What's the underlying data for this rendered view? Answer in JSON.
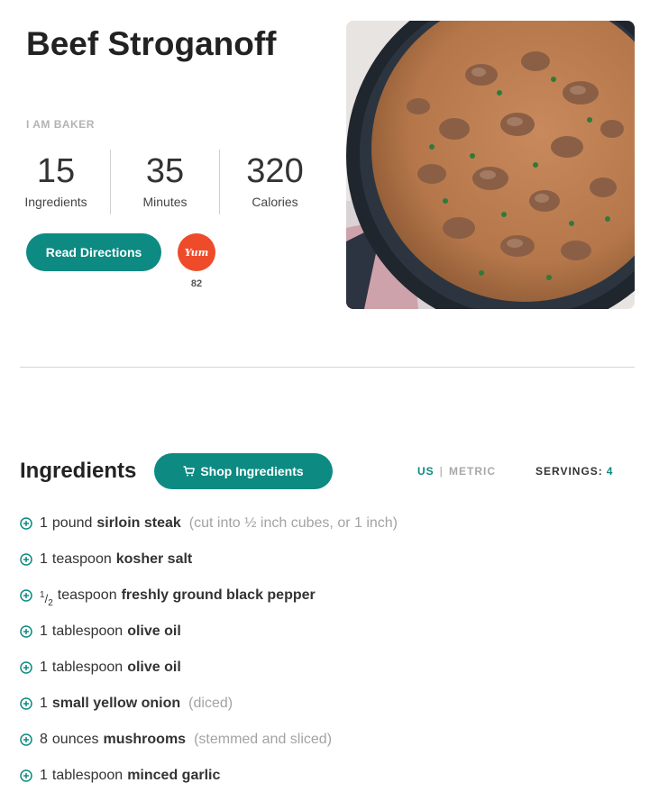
{
  "recipe": {
    "title": "Beef Stroganoff",
    "author": "I AM BAKER",
    "stats": [
      {
        "value": "15",
        "label": "Ingredients"
      },
      {
        "value": "35",
        "label": "Minutes"
      },
      {
        "value": "320",
        "label": "Calories"
      }
    ],
    "read_directions_label": "Read Directions",
    "yum_label": "Yum",
    "yum_count": "82",
    "photo_icon": "beef-stroganoff-skillet-photo"
  },
  "ingredients": {
    "heading": "Ingredients",
    "shop_label": "Shop Ingredients",
    "shop_icon": "cart-icon",
    "unit_us": "US",
    "unit_separator": "|",
    "unit_metric": "METRIC",
    "servings_label": "SERVINGS:",
    "servings_value": "4",
    "items": [
      {
        "qty": "1",
        "unit": "pound",
        "name": "sirloin steak",
        "note": "(cut into ½ inch cubes, or 1 inch)"
      },
      {
        "qty": "1",
        "unit": "teaspoon",
        "name": "kosher salt",
        "note": ""
      },
      {
        "qty_num": "1",
        "qty_slash": "/",
        "qty_den": "2",
        "unit": "teaspoon",
        "name": "freshly ground black pepper",
        "note": ""
      },
      {
        "qty": "1",
        "unit": "tablespoon",
        "name": "olive oil",
        "note": ""
      },
      {
        "qty": "1",
        "unit": "tablespoon",
        "name": "olive oil",
        "note": ""
      },
      {
        "qty": "1",
        "unit": "",
        "name": "small yellow onion",
        "note": "(diced)"
      },
      {
        "qty": "8",
        "unit": "ounces",
        "name": "mushrooms",
        "note": "(stemmed and sliced)"
      },
      {
        "qty": "1",
        "unit": "tablespoon",
        "name": "minced garlic",
        "note": ""
      }
    ]
  },
  "colors": {
    "accent": "#0d8a82",
    "yum": "#ee4b2b",
    "muted_text": "#a3a3a3"
  }
}
